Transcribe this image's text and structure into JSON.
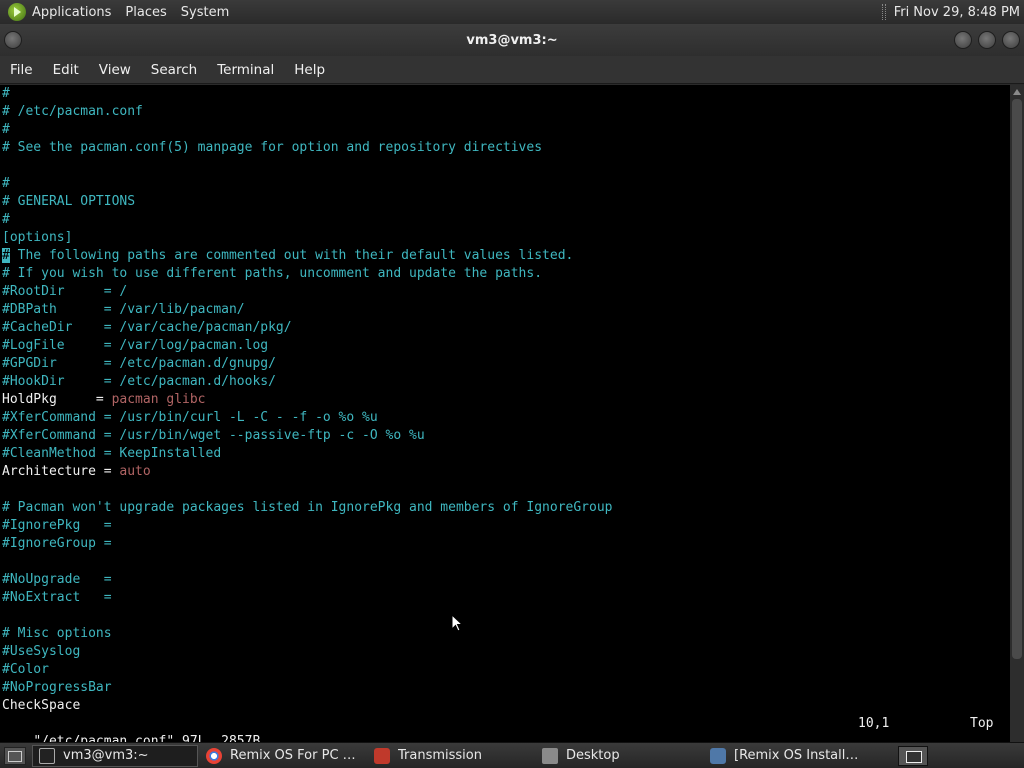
{
  "top_panel": {
    "menus": [
      "Applications",
      "Places",
      "System"
    ],
    "clock": "Fri Nov 29,  8:48 PM"
  },
  "window": {
    "title": "vm3@vm3:~",
    "menubar": [
      "File",
      "Edit",
      "View",
      "Search",
      "Terminal",
      "Help"
    ]
  },
  "terminal": {
    "lines": [
      [
        [
          "c",
          "#"
        ]
      ],
      [
        [
          "c",
          "# /etc/pacman.conf"
        ]
      ],
      [
        [
          "c",
          "#"
        ]
      ],
      [
        [
          "c",
          "# See the pacman.conf(5) manpage for option and repository directives"
        ]
      ],
      [],
      [
        [
          "c",
          "#"
        ]
      ],
      [
        [
          "c",
          "# GENERAL OPTIONS"
        ]
      ],
      [
        [
          "c",
          "#"
        ]
      ],
      [
        [
          "c",
          "[options]"
        ]
      ],
      [
        [
          "k",
          "#"
        ],
        [
          "c",
          " The following paths are commented out with their default values listed."
        ]
      ],
      [
        [
          "c",
          "# If you wish to use different paths, uncomment and update the paths."
        ]
      ],
      [
        [
          "c",
          "#RootDir     = /"
        ]
      ],
      [
        [
          "c",
          "#DBPath      = /var/lib/pacman/"
        ]
      ],
      [
        [
          "c",
          "#CacheDir    = /var/cache/pacman/pkg/"
        ]
      ],
      [
        [
          "c",
          "#LogFile     = /var/log/pacman.log"
        ]
      ],
      [
        [
          "c",
          "#GPGDir      = /etc/pacman.d/gnupg/"
        ]
      ],
      [
        [
          "c",
          "#HookDir     = /etc/pacman.d/hooks/"
        ]
      ],
      [
        [
          "w",
          "HoldPkg     = "
        ],
        [
          "s",
          "pacman glibc"
        ]
      ],
      [
        [
          "c",
          "#XferCommand = /usr/bin/curl -L -C - -f -o %o %u"
        ]
      ],
      [
        [
          "c",
          "#XferCommand = /usr/bin/wget --passive-ftp -c -O %o %u"
        ]
      ],
      [
        [
          "c",
          "#CleanMethod = KeepInstalled"
        ]
      ],
      [
        [
          "w",
          "Architecture = "
        ],
        [
          "s",
          "auto"
        ]
      ],
      [],
      [
        [
          "c",
          "# Pacman won't upgrade packages listed in IgnorePkg and members of IgnoreGroup"
        ]
      ],
      [
        [
          "c",
          "#IgnorePkg   ="
        ]
      ],
      [
        [
          "c",
          "#IgnoreGroup ="
        ]
      ],
      [],
      [
        [
          "c",
          "#NoUpgrade   ="
        ]
      ],
      [
        [
          "c",
          "#NoExtract   ="
        ]
      ],
      [],
      [
        [
          "c",
          "# Misc options"
        ]
      ],
      [
        [
          "c",
          "#UseSyslog"
        ]
      ],
      [
        [
          "c",
          "#Color"
        ]
      ],
      [
        [
          "c",
          "#NoProgressBar"
        ]
      ],
      [
        [
          "w",
          "CheckSpace"
        ]
      ]
    ],
    "status": {
      "file_info": "\"/etc/pacman.conf\" 97L, 2857B",
      "position": "10,1",
      "percent": "Top"
    }
  },
  "taskbar": {
    "tasks": [
      {
        "label": "vm3@vm3:~",
        "icon": "terminal-icon",
        "active": true
      },
      {
        "label": "Remix OS For PC An...",
        "icon": "chrome-icon",
        "active": false
      },
      {
        "label": "Transmission",
        "icon": "transmission-icon",
        "active": false
      },
      {
        "label": "Desktop",
        "icon": "folder-icon",
        "active": false
      },
      {
        "label": "[Remix OS Installati...",
        "icon": "virtualbox-icon",
        "active": false
      }
    ]
  },
  "colors": {
    "comment": "#3fb7c0",
    "text": "#f0f0f0",
    "string": "#b06464",
    "background": "#000000"
  }
}
